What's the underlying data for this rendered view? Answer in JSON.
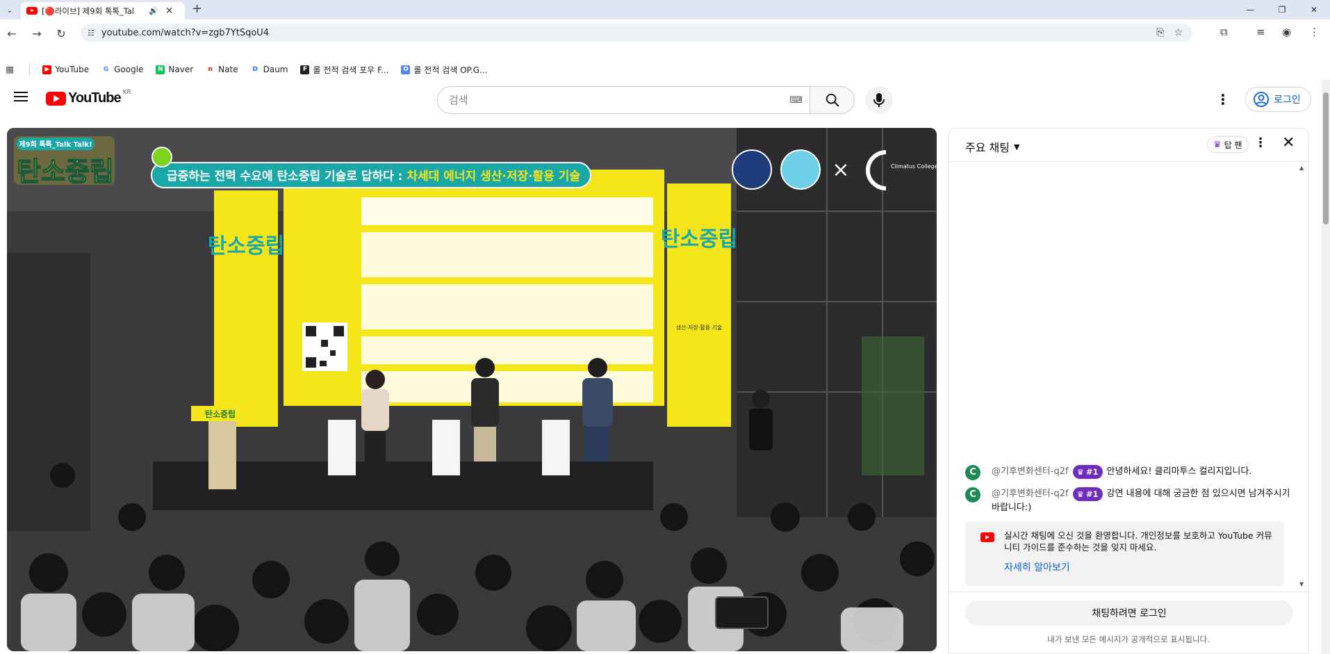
{
  "browser": {
    "tab_title": "[🔴라이브] 제9회 톡톡_Tal",
    "url": "youtube.com/watch?v=zgb7YtSqoU4",
    "bookmarks": [
      {
        "label": "YouTube",
        "color": "#ff0000",
        "glyph": "▶"
      },
      {
        "label": "Google",
        "color": "#4285f4",
        "glyph": "G"
      },
      {
        "label": "Naver",
        "color": "#03c75a",
        "glyph": "N"
      },
      {
        "label": "Nate",
        "color": "#e60012",
        "glyph": "n"
      },
      {
        "label": "Daum",
        "color": "#1f6fe5",
        "glyph": "D"
      },
      {
        "label": "롤 전적 검색 포우 F...",
        "color": "#222222",
        "glyph": "F"
      },
      {
        "label": "롤 전적 검색 OP.G...",
        "color": "#5383e8",
        "glyph": "O"
      }
    ]
  },
  "masthead": {
    "logo_text": "YouTube",
    "country": "KR",
    "search_placeholder": "검색",
    "login_label": "로그인"
  },
  "video": {
    "event_badge": "제9회 톡톡_Talk Talk!",
    "event_logo": "탄소중립",
    "headline_part1": "급증하는 전력 수요에 탄소중립 기술로 답하다 : ",
    "headline_part2": "차세대 에너지 생산·저장·활용 기술",
    "banner_left": "탄소중립",
    "banner_right": "탄소중립",
    "banner_right_sub": "생산·저장·활용 기술",
    "podium_label": "탄소중립",
    "partner_text": "Climatus College",
    "cross": "×"
  },
  "chat": {
    "title": "주요 채팅",
    "top_fan_label": "탑 팬",
    "messages": [
      {
        "avatar": "C",
        "author": "@기후변화센터-q2f",
        "badge": "#1",
        "text": "안녕하세요! 클리마투스 컬리지입니다."
      },
      {
        "avatar": "C",
        "author": "@기후변화센터-q2f",
        "badge": "#1",
        "text": "강연 내용에 대해 궁금한 점 있으시면 남겨주시기 바랍니다:)"
      }
    ],
    "welcome_text": "실시간 채팅에 오신 것을 환영합니다. 개인정보를 보호하고 YouTube 커뮤니티 가이드를 준수하는 것을 잊지 마세요.",
    "welcome_link": "자세히 알아보기",
    "login_prompt": "채팅하려면 로그인",
    "public_note": "내가 보낸 모든 메시지가 공개적으로 표시됩니다."
  },
  "colors": {
    "brand_red": "#ff0000",
    "link_blue": "#065fd4",
    "top_fan_purple": "#6f2dbd",
    "event_teal": "#1aa7a7",
    "event_yellow": "#f4e61b"
  }
}
